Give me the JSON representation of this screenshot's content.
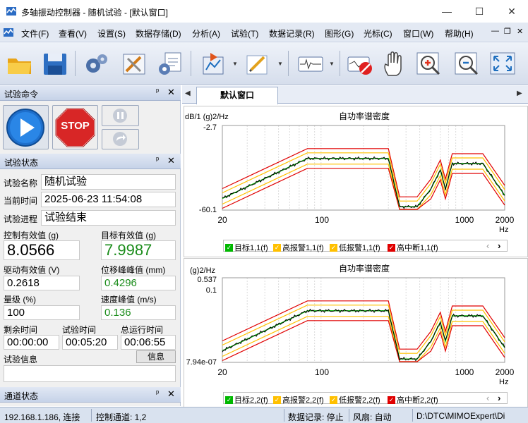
{
  "window": {
    "title": "多轴振动控制器 - 随机试验 - [默认窗口]",
    "minimize": "—",
    "maximize": "☐",
    "close": "✕"
  },
  "menu": [
    "文件(F)",
    "查看(V)",
    "设置(S)",
    "数据存储(D)",
    "分析(A)",
    "试验(T)",
    "数据记录(R)",
    "图形(G)",
    "光标(C)",
    "窗口(W)",
    "帮助(H)"
  ],
  "mdi_controls": {
    "minimize": "—",
    "restore": "❐",
    "close": "✕"
  },
  "toolbar_icons": [
    "open-folder-icon",
    "save-icon",
    "settings-gears-icon",
    "configure-tools-icon",
    "parameters-icon",
    "run-test-icon",
    "edit-icon",
    "waveform-icon",
    "stop-record-icon",
    "hand-pan-icon",
    "zoom-in-icon",
    "zoom-out-icon",
    "fit-view-icon"
  ],
  "panels": {
    "test_command": {
      "title": "试验命令",
      "pin": "ᵖ",
      "close": "✕",
      "stop_label": "STOP"
    },
    "test_status": {
      "title": "试验状态",
      "pin": "ᵖ",
      "close": "✕",
      "test_name_label": "试验名称",
      "test_name": "随机试验",
      "current_time_label": "当前时间",
      "current_time": "2025-06-23 11:54:08",
      "progress_label": "试验进程",
      "progress": "试验结束",
      "ctrl_rms_label": "控制有效值 (g)",
      "ctrl_rms": "8.0566",
      "target_rms_label": "目标有效值 (g)",
      "target_rms": "7.9987",
      "drive_rms_label": "驱动有效值 (V)",
      "drive_rms": "0.2618",
      "disp_pp_label": "位移峰峰值 (mm)",
      "disp_pp": "0.4296",
      "level_label": "量级 (%)",
      "level": "100",
      "vel_peak_label": "速度峰值 (m/s)",
      "vel_peak": "0.136",
      "remaining_label": "剩余时间",
      "remaining": "00:00:00",
      "test_time_label": "试验时间",
      "test_time": "00:05:20",
      "total_time_label": "总运行时间",
      "total_time": "00:06:55",
      "info_label": "试验信息",
      "info_button": "信息"
    },
    "channel_status": {
      "title": "通道状态",
      "pin": "ᵖ",
      "close": "✕"
    }
  },
  "document": {
    "tab_label": "默认窗口",
    "nav_left": "◀",
    "nav_right": "▶"
  },
  "charts": [
    {
      "title": "自功率谱密度",
      "ylabel": "dB/1 (g)2/Hz",
      "ytop": "-2.7",
      "ybottom": "-60.1",
      "xticks": [
        "20",
        "100",
        "1000",
        "2000"
      ],
      "xunit": "Hz",
      "legend": [
        {
          "name": "目标1,1(f)",
          "color": "#00b800",
          "mark": "✓"
        },
        {
          "name": "高报警1,1(f)",
          "color": "#ffc000",
          "mark": "✓"
        },
        {
          "name": "低报警1,1(f)",
          "color": "#ffc000",
          "mark": "✓"
        },
        {
          "name": "高中断1,1(f)",
          "color": "#e00000",
          "mark": "✓"
        }
      ],
      "legend_prev": "‹",
      "legend_next": "›"
    },
    {
      "title": "自功率谱密度",
      "ylabel": "(g)2/Hz",
      "ytop": "0.537",
      "ymid": "0.1",
      "ybottom": "7.94e-07",
      "xticks": [
        "20",
        "100",
        "1000",
        "2000"
      ],
      "xunit": "Hz",
      "legend": [
        {
          "name": "目标2,2(f)",
          "color": "#00b800",
          "mark": "✓"
        },
        {
          "name": "高报警2,2(f)",
          "color": "#ffc000",
          "mark": "✓"
        },
        {
          "name": "低报警2,2(f)",
          "color": "#ffc000",
          "mark": "✓"
        },
        {
          "name": "高中断2,2(f)",
          "color": "#e00000",
          "mark": "✓"
        }
      ],
      "legend_prev": "‹",
      "legend_next": "›"
    }
  ],
  "statusbar": {
    "address": "192.168.1.186, 连接",
    "channels": "控制通道: 1,2",
    "recording": "数据记录: 停止",
    "fan": "风扇: 自动",
    "path": "D:\\DTC\\MIMOExpert\\Di"
  },
  "colors": {
    "target": "#00b800",
    "alarm": "#ffc000",
    "abort": "#e00000",
    "control": "#000000",
    "accent": "#1f6fbf"
  }
}
